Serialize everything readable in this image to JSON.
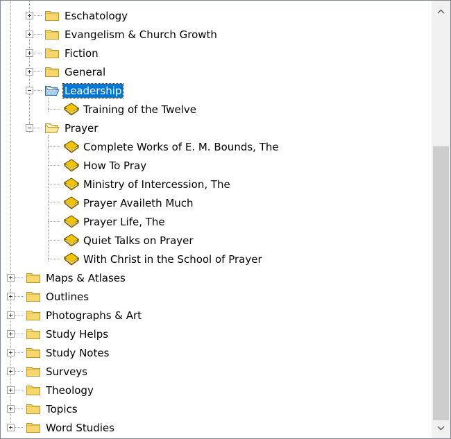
{
  "tree": {
    "items": [
      {
        "label": "Eschatology",
        "type": "folder",
        "state": "collapsed",
        "level": 1
      },
      {
        "label": "Evangelism & Church Growth",
        "type": "folder",
        "state": "collapsed",
        "level": 1
      },
      {
        "label": "Fiction",
        "type": "folder",
        "state": "collapsed",
        "level": 1
      },
      {
        "label": "General",
        "type": "folder",
        "state": "collapsed",
        "level": 1
      },
      {
        "label": "Leadership",
        "type": "folder",
        "state": "expanded",
        "level": 1,
        "selected": true
      },
      {
        "label": "Training of the Twelve",
        "type": "book",
        "level": 2
      },
      {
        "label": "Prayer",
        "type": "folder",
        "state": "expanded",
        "level": 1
      },
      {
        "label": "Complete Works of E. M. Bounds, The",
        "type": "book",
        "level": 2
      },
      {
        "label": "How To Pray",
        "type": "book",
        "level": 2
      },
      {
        "label": "Ministry of Intercession, The",
        "type": "book",
        "level": 2
      },
      {
        "label": "Prayer Availeth Much",
        "type": "book",
        "level": 2
      },
      {
        "label": "Prayer Life, The",
        "type": "book",
        "level": 2
      },
      {
        "label": "Quiet Talks on Prayer",
        "type": "book",
        "level": 2
      },
      {
        "label": "With Christ in the School of Prayer",
        "type": "book",
        "level": 2
      },
      {
        "label": "Maps & Atlases",
        "type": "folder",
        "state": "collapsed",
        "level": 0
      },
      {
        "label": "Outlines",
        "type": "folder",
        "state": "collapsed",
        "level": 0
      },
      {
        "label": "Photographs & Art",
        "type": "folder",
        "state": "collapsed",
        "level": 0
      },
      {
        "label": "Study Helps",
        "type": "folder",
        "state": "collapsed",
        "level": 0
      },
      {
        "label": "Study Notes",
        "type": "folder",
        "state": "collapsed",
        "level": 0
      },
      {
        "label": "Surveys",
        "type": "folder",
        "state": "collapsed",
        "level": 0
      },
      {
        "label": "Theology",
        "type": "folder",
        "state": "collapsed",
        "level": 0
      },
      {
        "label": "Topics",
        "type": "folder",
        "state": "collapsed",
        "level": 0
      },
      {
        "label": "Word Studies",
        "type": "folder",
        "state": "collapsed",
        "level": 0
      }
    ]
  },
  "scrollbar": {
    "up_icon": "chevron-up-icon",
    "down_icon": "chevron-down-icon",
    "position_fraction": 0.32
  },
  "colors": {
    "selection": "#0078d7",
    "folder": "#f5d76e",
    "book": "#f2c300",
    "scroll_thumb": "#cdcdcd"
  }
}
